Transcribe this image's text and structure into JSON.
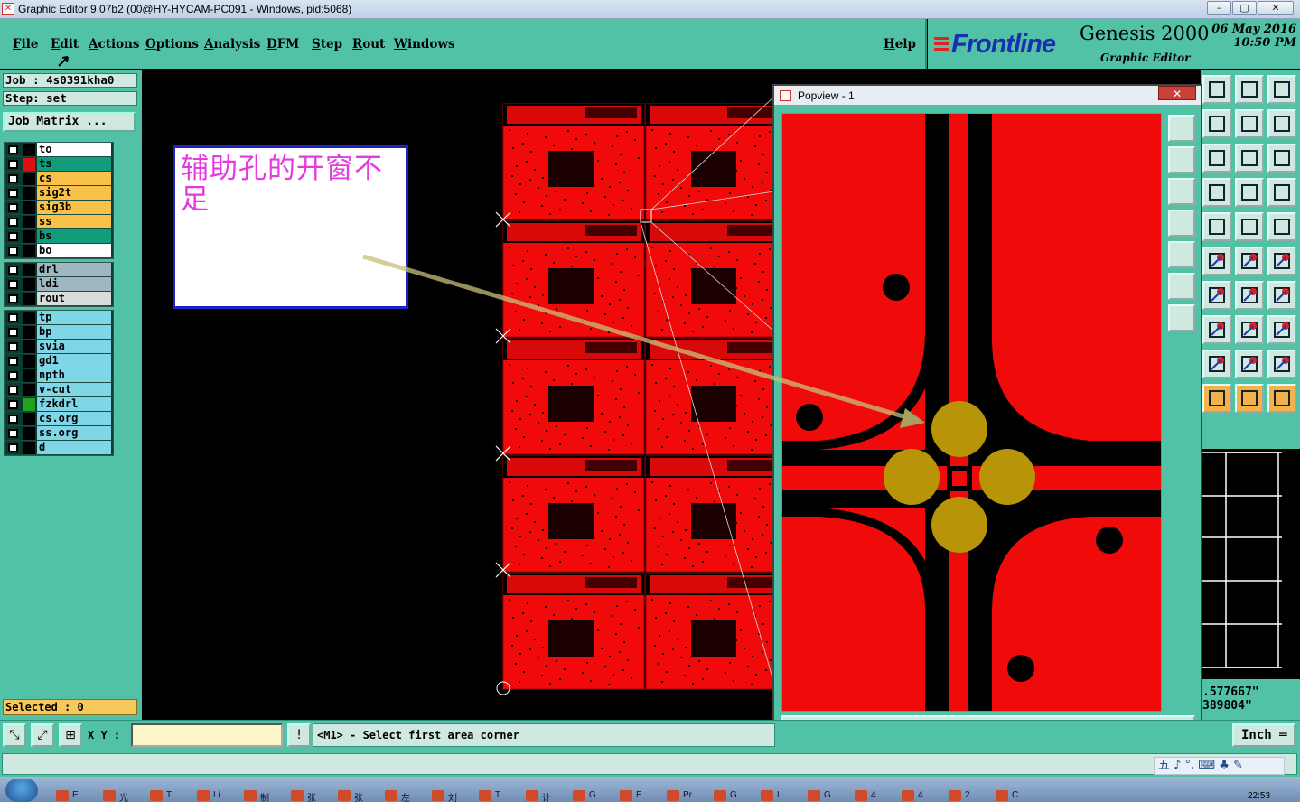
{
  "window": {
    "title": "Graphic Editor 9.07b2 (00@HY-HYCAM-PC091 - Windows, pid:5068)",
    "controls": [
      "–",
      "▢",
      "✕"
    ]
  },
  "menu": {
    "items": [
      "File",
      "Edit",
      "Actions",
      "Options",
      "Analysis",
      "DFM",
      "Step",
      "Rout",
      "Windows"
    ],
    "help": "Help"
  },
  "brand": {
    "logo": "Frontline",
    "product": "Genesis 2000",
    "subtitle": "Graphic Editor",
    "date": "06 May 2016",
    "time": "10:50 PM"
  },
  "job": {
    "job_line": "Job : 4s0391kha0",
    "step_line": "Step: set",
    "matrix_button": "Job Matrix ..."
  },
  "layers": {
    "group1": [
      {
        "name": "to",
        "color": "#ffffff",
        "swatch": "#000000"
      },
      {
        "name": "ts",
        "color": "#129c7c",
        "swatch": "#e01010"
      },
      {
        "name": "cs",
        "color": "#f8c24a",
        "swatch": "#000000"
      },
      {
        "name": "sig2t",
        "color": "#f8c24a",
        "swatch": "#000000"
      },
      {
        "name": "sig3b",
        "color": "#f8c24a",
        "swatch": "#000000"
      },
      {
        "name": "ss",
        "color": "#f8c24a",
        "swatch": "#000000"
      },
      {
        "name": "bs",
        "color": "#129c7c",
        "swatch": "#000000"
      },
      {
        "name": "bo",
        "color": "#ffffff",
        "swatch": "#000000"
      }
    ],
    "group2": [
      {
        "name": "drl",
        "color": "#9fb7c2",
        "swatch": "#000000"
      },
      {
        "name": "ldi",
        "color": "#9fb7c2",
        "swatch": "#000000"
      },
      {
        "name": "rout",
        "color": "#d8dcdc",
        "swatch": "#000000"
      }
    ],
    "group3": [
      {
        "name": "tp",
        "color": "#7fd6e6",
        "swatch": "#000000"
      },
      {
        "name": "bp",
        "color": "#7fd6e6",
        "swatch": "#000000"
      },
      {
        "name": "svia",
        "color": "#7fd6e6",
        "swatch": "#000000"
      },
      {
        "name": "gd1",
        "color": "#7fd6e6",
        "swatch": "#000000"
      },
      {
        "name": "npth",
        "color": "#7fd6e6",
        "swatch": "#000000"
      },
      {
        "name": "v-cut",
        "color": "#7fd6e6",
        "swatch": "#000000"
      },
      {
        "name": "fzkdrl",
        "color": "#7fd6e6",
        "swatch": "#22a020"
      },
      {
        "name": "cs.org",
        "color": "#7fd6e6",
        "swatch": "#000000"
      },
      {
        "name": "ss.org",
        "color": "#7fd6e6",
        "swatch": "#000000"
      },
      {
        "name": "d",
        "color": "#7fd6e6",
        "swatch": "#000000"
      }
    ]
  },
  "selected": "Selected : 0",
  "annotation": {
    "text": "辅助孔的开窗不足"
  },
  "status": {
    "xy_label": "X Y :",
    "xy_value": "",
    "prompt": "<M1> - Select first area corner",
    "units": "Inch ═"
  },
  "coords": {
    "x": ".577667\"",
    "y": "389804\""
  },
  "popview": {
    "title": "Popview - 1",
    "close": "Close"
  },
  "taskbar": {
    "items": [
      "E",
      "光",
      "T",
      "Li",
      "制",
      "张",
      "张",
      "左",
      "刘",
      "T",
      "计",
      "G",
      "E",
      "Pr",
      "G",
      "L",
      "G",
      "4",
      "4",
      "2",
      "C"
    ],
    "clock": "22:53"
  },
  "tray": {
    "text": "五 ♪ °, ⌨ ♣ ✎"
  }
}
